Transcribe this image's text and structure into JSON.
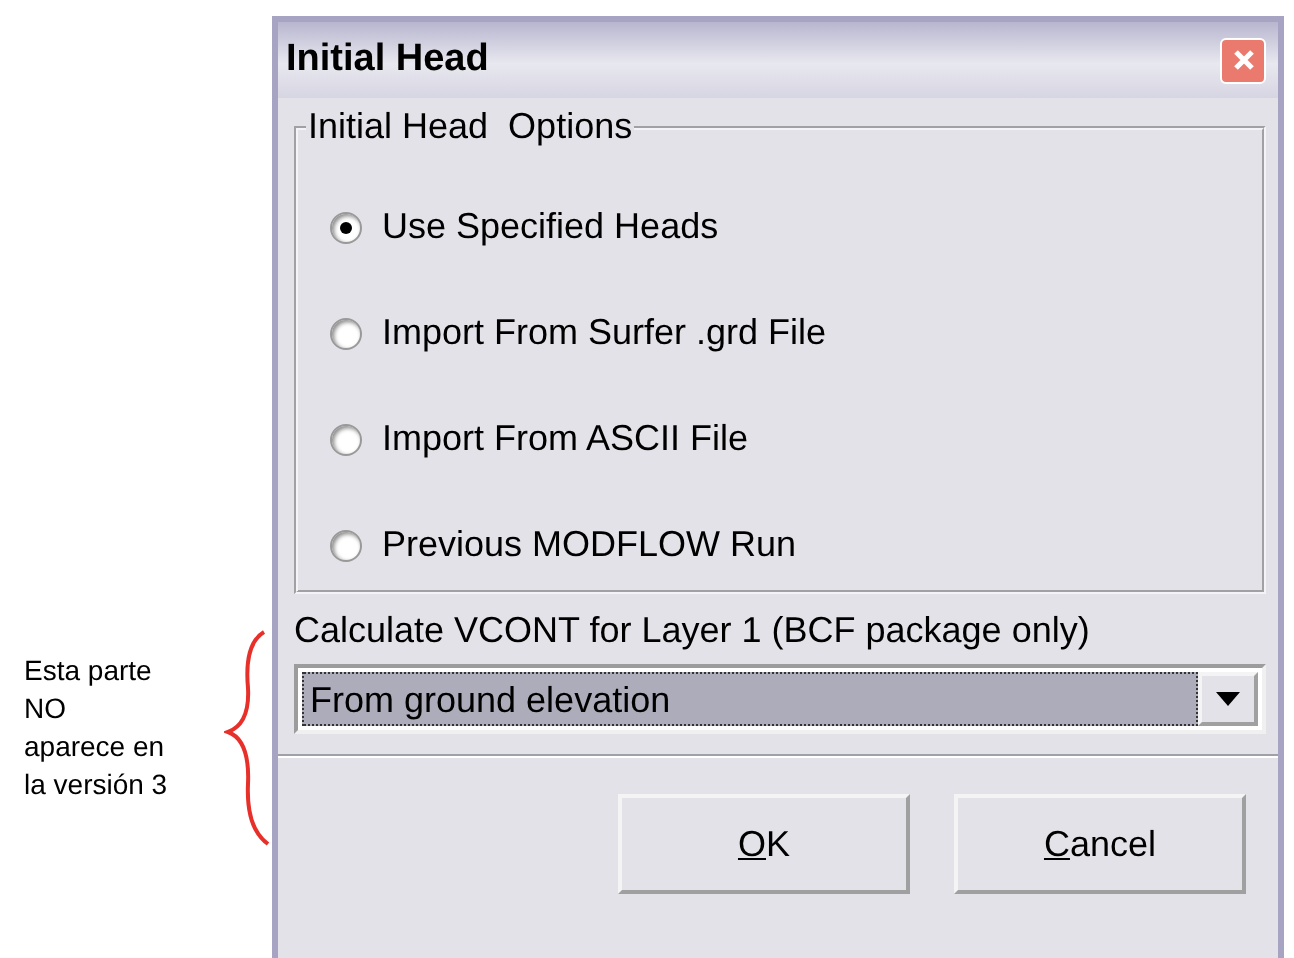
{
  "annotation": {
    "lines": [
      "Esta parte",
      "NO",
      "aparece en",
      "la versión 3"
    ]
  },
  "window": {
    "title": "Initial Head"
  },
  "options_group": {
    "title": "Initial Head  Options",
    "options": [
      {
        "label": "Use Specified Heads",
        "selected": true
      },
      {
        "label": "Import From Surfer .grd File",
        "selected": false
      },
      {
        "label": "Import From ASCII File",
        "selected": false
      },
      {
        "label": "Previous MODFLOW Run",
        "selected": false
      }
    ]
  },
  "vcont": {
    "label": "Calculate VCONT for Layer 1 (BCF package only)",
    "value": "From ground elevation"
  },
  "buttons": [
    {
      "label": "OK",
      "underline_first": true
    },
    {
      "label": "Cancel",
      "underline_first": true
    }
  ]
}
